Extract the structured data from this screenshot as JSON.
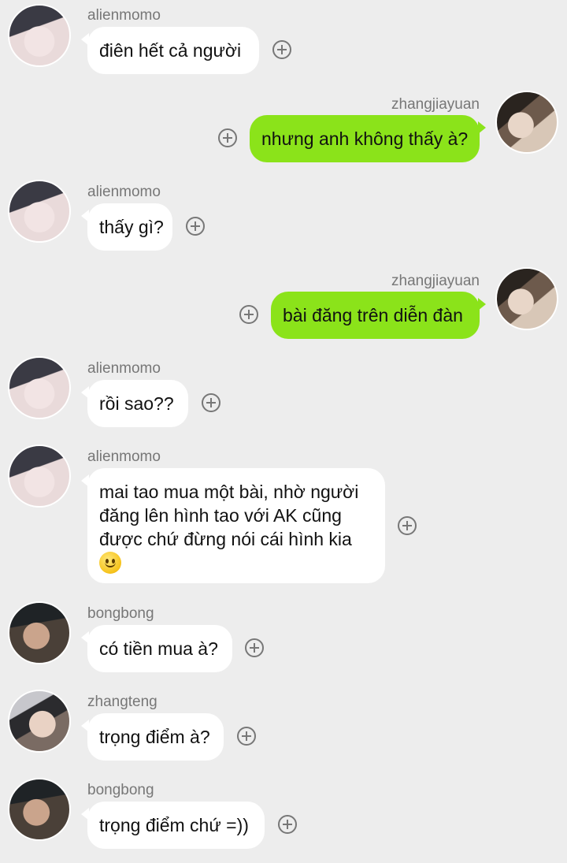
{
  "messages": [
    {
      "sender": "alienmomo",
      "side": "left",
      "text": "điên hết cả người"
    },
    {
      "sender": "zhangjiayuan",
      "side": "right",
      "text": "nhưng anh không thấy à?"
    },
    {
      "sender": "alienmomo",
      "side": "left",
      "text": "thấy gì?"
    },
    {
      "sender": "zhangjiayuan",
      "side": "right",
      "text": "bài đăng trên diễn đàn"
    },
    {
      "sender": "alienmomo",
      "side": "left",
      "text": "rồi sao??"
    },
    {
      "sender": "alienmomo",
      "side": "left",
      "text_lines": [
        "mai tao mua một bài, nhờ người",
        "đăng lên hình tao với AK cũng",
        "được chứ đừng nói cái hình kia"
      ],
      "emoji": "smiling-face-emoji"
    },
    {
      "sender": "bongbong",
      "side": "left",
      "text": "có tiền mua à?"
    },
    {
      "sender": "zhangteng",
      "side": "left",
      "text": "trọng điểm à?"
    },
    {
      "sender": "bongbong",
      "side": "left",
      "text": "trọng điểm chứ =))"
    }
  ],
  "icons": {
    "add": "plus-circle-icon",
    "avatar": "avatar-image"
  },
  "colors": {
    "background": "#ededed",
    "incoming_bubble": "#ffffff",
    "outgoing_bubble": "#8be31a",
    "name_text": "#777777"
  }
}
